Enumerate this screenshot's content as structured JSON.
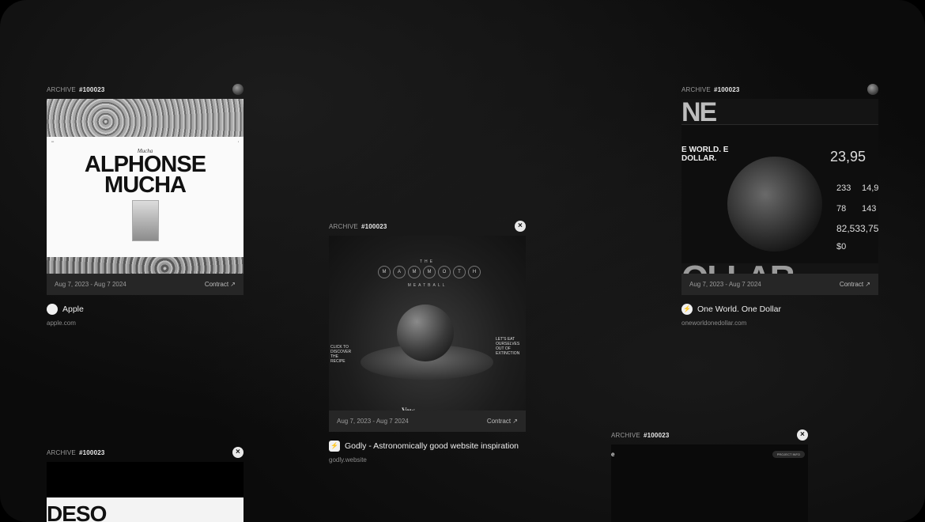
{
  "cards": [
    {
      "archive_label": "ARCHIVE",
      "archive_id": "#100023",
      "date_range": "Aug 7, 2023 - Aug 7 2024",
      "contract_label": "Contract ↗",
      "site_name": "Apple",
      "site_url": "apple.com",
      "preview": {
        "headline": "ALPHONSE MUCHA",
        "signature": "Mucha"
      }
    },
    {
      "archive_label": "ARCHIVE",
      "archive_id": "#100023",
      "date_range": "Aug 7, 2023 - Aug 7 2024",
      "contract_label": "Contract ↗",
      "site_name": "Godly -  Astronomically good website inspiration",
      "site_url": "godly.website",
      "preview": {
        "kicker": "THE",
        "title_letters": [
          "M",
          "A",
          "M",
          "M",
          "O",
          "T",
          "H"
        ],
        "subtitle": "MEATBALL",
        "left_text": "CLICK TO DISCOVER THE RECIPE",
        "right_text": "LET'S EAT OURSELVES OUT OF EXTINCTION",
        "brand": "Vow"
      }
    },
    {
      "archive_label": "ARCHIVE",
      "archive_id": "#100023",
      "date_range": "Aug 7, 2023 - Aug 7 2024",
      "contract_label": "Contract ↗",
      "site_name": "One World. One Dollar",
      "site_url": "oneworldonedollar.com",
      "preview": {
        "top_word": "NE",
        "headline": "E WORLD. E DOLLAR.",
        "stat_main": "23,95",
        "stat_a": "233",
        "stat_b": "14,9",
        "stat_c": "78",
        "stat_d": "143",
        "stat_total": "82,533,75",
        "stat_zero": "$0",
        "bottom_word": "OLLAR."
      }
    },
    {
      "archive_label": "ARCHIVE",
      "archive_id": "#100023",
      "preview": {
        "word": "DESO"
      }
    },
    {
      "archive_label": "ARCHIVE",
      "archive_id": "#100023",
      "preview": {
        "letter": "e",
        "pill": "PROJECT INFO"
      }
    }
  ],
  "colors": {
    "background": "#0b0b0b",
    "card_footer": "#262626",
    "accent_light": "#f0f0f0"
  },
  "icons": {
    "close": "close-icon",
    "contract_arrow": "arrow-up-right-icon",
    "apple": "apple-logo-icon",
    "godly": "bolt-icon"
  }
}
